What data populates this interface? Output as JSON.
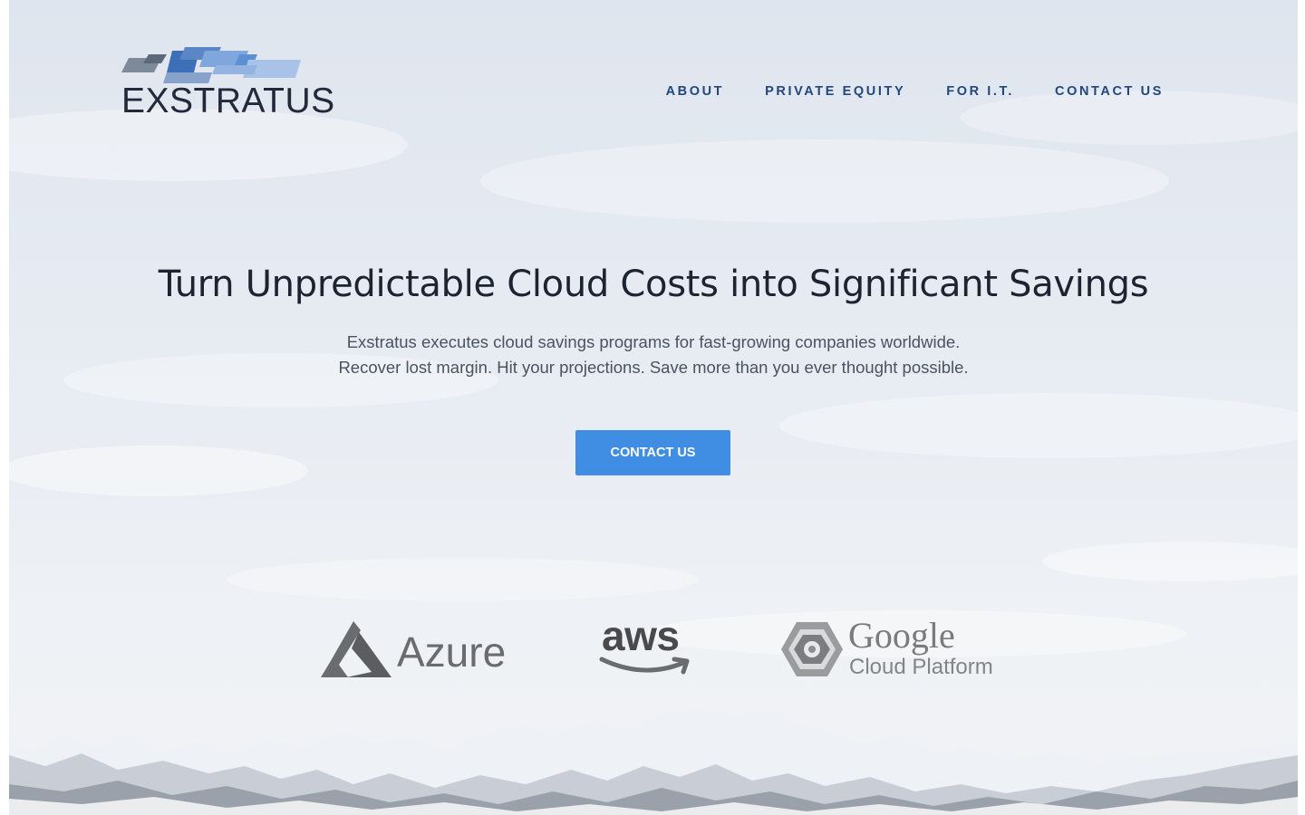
{
  "brand": {
    "name": "EXSTRATUS"
  },
  "nav": {
    "items": [
      {
        "label": "ABOUT"
      },
      {
        "label": "PRIVATE EQUITY"
      },
      {
        "label": "FOR I.T."
      },
      {
        "label": "CONTACT US"
      }
    ]
  },
  "hero": {
    "title": "Turn Unpredictable Cloud Costs into Significant Savings",
    "subtitle_line1": "Exstratus executes cloud savings programs for fast-growing companies worldwide.",
    "subtitle_line2": "Recover lost margin. Hit your projections. Save more than you ever thought possible.",
    "cta_label": "CONTACT US"
  },
  "partners": {
    "azure": "Azure",
    "aws": "aws",
    "google": "Google",
    "cloud_platform": "Cloud Platform"
  },
  "colors": {
    "nav_text": "#23477a",
    "cta_background": "#3f8ee3",
    "title_text": "#1d2330",
    "body_text": "#4b5260",
    "logo_blues": [
      "#3d6fb8",
      "#7fa6dd",
      "#a9c3e8",
      "#7e8a99"
    ]
  }
}
